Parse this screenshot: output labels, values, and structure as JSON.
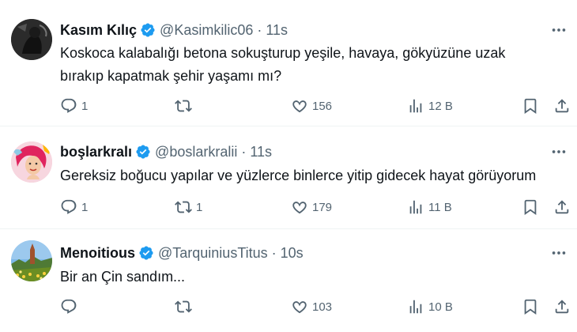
{
  "tweets": [
    {
      "name": "Kasım Kılıç",
      "handle": "@Kasimkilic06",
      "dot": "·",
      "time": "11s",
      "text_line1": "Koskoca kalabalığı betona sokuşturup yeşile, havaya, gökyüzüne uzak",
      "text_line2": "bırakıp kapatmak şehir yaşamı mı?",
      "replies": "1",
      "reposts": "",
      "likes": "156",
      "views": "12 B"
    },
    {
      "name": "boşlarkralı",
      "handle": "@boslarkralii",
      "dot": "·",
      "time": "11s",
      "text_line1": "Gereksiz boğucu yapılar ve yüzlerce binlerce yitip gidecek hayat görüyorum",
      "text_line2": "",
      "replies": "1",
      "reposts": "1",
      "likes": "179",
      "views": "11 B"
    },
    {
      "name": "Menoitious",
      "handle": "@TarquiniusTitus",
      "dot": "·",
      "time": "10s",
      "text_line1": "Bir an Çin sandım...",
      "text_line2": "",
      "replies": "",
      "reposts": "",
      "likes": "103",
      "views": "10 B"
    }
  ],
  "colors": {
    "text": "#0f1419",
    "secondary": "#536471",
    "verified": "#1d9bf0",
    "divider": "#eff3f4"
  },
  "icons": [
    "reply-icon",
    "repost-icon",
    "like-icon",
    "views-icon",
    "bookmark-icon",
    "share-icon",
    "more-icon",
    "verified-badge-icon"
  ]
}
